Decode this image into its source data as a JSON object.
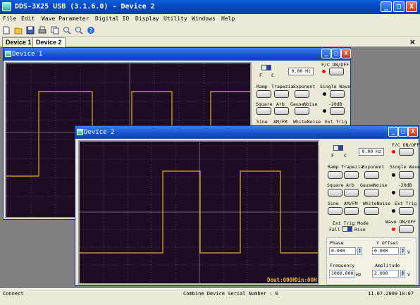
{
  "app": {
    "title": "DDS-3X25 USB (3.1.6.0) - Device 2",
    "window_buttons": [
      "_",
      "□",
      "X"
    ]
  },
  "menu": [
    "File",
    "Edit",
    "Wave Parameter",
    "Digital IO",
    "Display",
    "Utility",
    "Windows",
    "Help"
  ],
  "toolbar": [
    "new-icon",
    "open-icon",
    "save-icon",
    "print-icon",
    "copy-icon",
    "zoom-in-icon",
    "zoom-out-icon",
    "help-icon"
  ],
  "tabs": [
    "Device 1",
    "Device 2"
  ],
  "tabs_close": "×",
  "device1": {
    "title": "Device 1",
    "panel": {
      "F": "F",
      "C": "C",
      "freq": "0.00 Hz",
      "fc_onoff": "F/C ON/OFF",
      "wave_row1": [
        "Ramp",
        "Trapezia",
        "Exponent"
      ],
      "single_wave": "Single Wave",
      "wave_row2": [
        "Square",
        "Arb",
        "Gause",
        "Noise"
      ],
      "minus20db": "-20dB",
      "wave_row3": [
        "Sine",
        "AM/FM",
        "WhiteNoise"
      ],
      "ext_trig": "Ext Trig"
    }
  },
  "device2": {
    "title": "Device 2",
    "readout_dout": "Dout:000H",
    "readout_din": "Din:00H",
    "panel": {
      "F": "F",
      "C": "C",
      "freq": "0.00 Hz",
      "fc_onoff": "F/C ON/OFF",
      "wave_row1": [
        "Ramp",
        "Trapezia",
        "Exponent"
      ],
      "single_wave": "Single Wave",
      "wave_row2": [
        "Square",
        "Arb",
        "Gause",
        "Noise"
      ],
      "minus20db": "-20dB",
      "wave_row3": [
        "Sine",
        "AM/FM",
        "WhiteNoise"
      ],
      "ext_trig": "Ext Trig",
      "ext_trig_mode": "Ext Trig Mode",
      "fall": "Fall",
      "rise": "Rise",
      "wave_onoff": "Wave ON/OFF",
      "phase_label": "Phase",
      "phase_value": "0.000",
      "yoffset_label": "Y Offset",
      "yoffset_value": "0.000",
      "yoffset_unit": "V",
      "frequency_label": "Frequency",
      "frequency_value": "1000.000",
      "frequency_unit": "Hz",
      "amplitude_label": "Amplitude",
      "amplitude_value": "2.000",
      "amplitude_unit": "V"
    }
  },
  "status": {
    "left": "Connect",
    "center": "Combine Device Serial Number : 0",
    "date": "11.07.2009",
    "time": "10:07"
  },
  "colors": {
    "scope_bg": "#1e0c22",
    "grid": "#6b5a6e",
    "trace": "#e0b020",
    "readout": "#f0c020"
  }
}
